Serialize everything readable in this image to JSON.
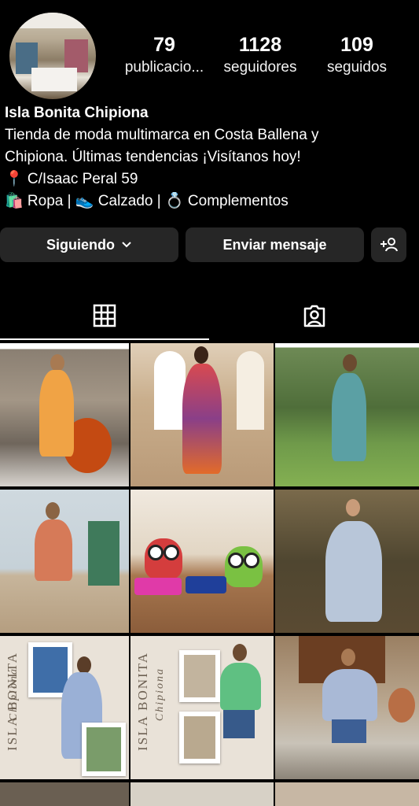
{
  "profile": {
    "stats": [
      {
        "value": "79",
        "label": "publicacio..."
      },
      {
        "value": "1128",
        "label": "seguidores"
      },
      {
        "value": "109",
        "label": "seguidos"
      }
    ],
    "name": "Isla Bonita Chipiona",
    "bio": [
      "Tienda de moda multimarca en Costa Ballena y",
      "Chipiona. Últimas tendencias ¡Visítanos hoy!",
      "📍 C/Isaac Peral 59",
      "🛍️ Ropa | 👟 Calzado | 💍 Complementos"
    ]
  },
  "actions": {
    "following_label": "Siguiendo",
    "message_label": "Enviar mensaje"
  },
  "tabs": [
    {
      "icon": "grid-icon",
      "active": true
    },
    {
      "icon": "tagged-person-icon",
      "active": false
    }
  ],
  "grid": {
    "posts": [
      {
        "icon": "orange-dress-photo"
      },
      {
        "icon": "red-dress-photo"
      },
      {
        "icon": "blue-halter-dress-photo"
      },
      {
        "icon": "beach-dress-photo"
      },
      {
        "icon": "owl-purses-photo"
      },
      {
        "icon": "white-tunic-photo"
      },
      {
        "icon": "blue-print-dress-collage"
      },
      {
        "icon": "green-shirt-collage"
      },
      {
        "icon": "denim-jacket-photo"
      }
    ],
    "collage_text": {
      "brand": "ISLA BONITA",
      "place": "Chipiona"
    }
  },
  "colors": {
    "background": "#000000",
    "button": "#262626",
    "text": "#ffffff"
  }
}
